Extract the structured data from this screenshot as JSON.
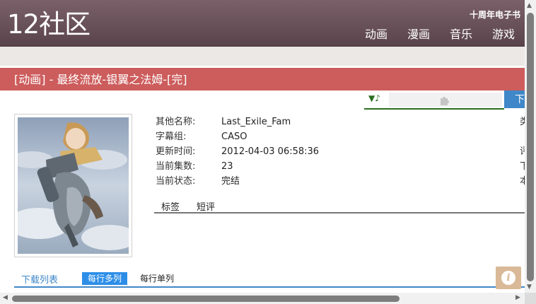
{
  "header": {
    "logo": "12社区",
    "top_link": "十周年电子书",
    "nav": [
      "动画",
      "漫画",
      "音乐",
      "游戏"
    ]
  },
  "page": {
    "title": "[动画] - 最终流放-银翼之法姆-[完]"
  },
  "player": {
    "music_icon": "▼♪",
    "puzzle_icon": "puzzle-icon"
  },
  "download_button": "下载",
  "info": {
    "rows": [
      {
        "label": "其他名称:",
        "value": "Last_Exile_Fam",
        "right": "类"
      },
      {
        "label": "字幕组:",
        "value": "CASO",
        "right": ""
      },
      {
        "label": "更新时间:",
        "value": "2012-04-03 06:58:36",
        "right": "评"
      },
      {
        "label": "当前集数:",
        "value": "23",
        "right": "下"
      },
      {
        "label": "当前状态:",
        "value": "完结",
        "right": "本"
      }
    ]
  },
  "tabs": [
    "标签",
    "短评"
  ],
  "download_list": {
    "title": "下载列表",
    "active_mode": "每行多列",
    "mode": "每行单列"
  },
  "info_icon": "i",
  "colors": {
    "header": "#6b5259",
    "title_bar": "#cd5c5c",
    "accent_blue": "#3f87c8",
    "player_green": "#2b6e1f"
  }
}
